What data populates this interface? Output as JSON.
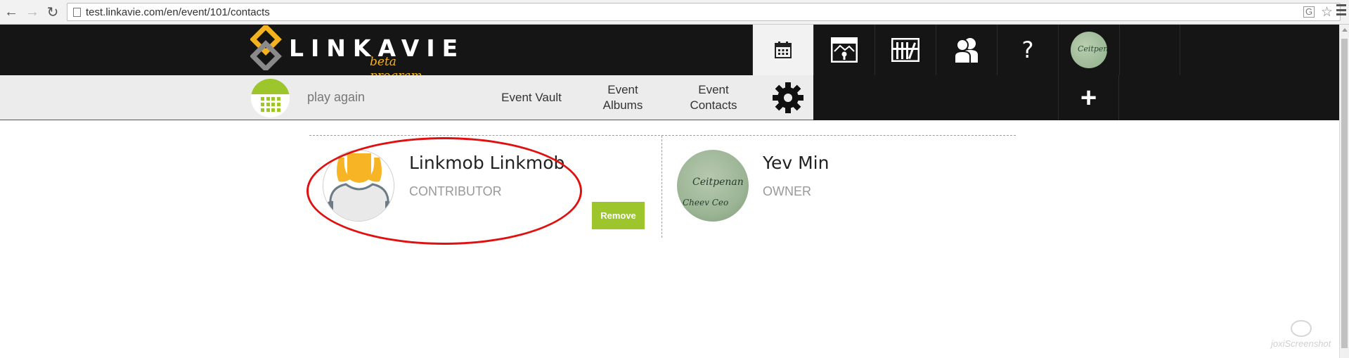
{
  "browser": {
    "url": "test.linkavie.com/en/event/101/contacts"
  },
  "brand": {
    "name": "LINKAVIE",
    "tagline": "beta program",
    "accent_color": "#f4b21e",
    "dark_color": "#151515"
  },
  "topnav": {
    "items": [
      {
        "name": "calendar-icon",
        "active": true
      },
      {
        "name": "vault-icon"
      },
      {
        "name": "albums-icon"
      },
      {
        "name": "contacts-icon"
      },
      {
        "name": "help",
        "label": "?"
      },
      {
        "name": "user-avatar"
      }
    ],
    "avatar_text": "Ceitpenan"
  },
  "event": {
    "name": "play again",
    "tabs": [
      {
        "label_1": "Event Vault",
        "label_2": ""
      },
      {
        "label_1": "Event",
        "label_2": "Albums"
      },
      {
        "label_1": "Event",
        "label_2": "Contacts"
      }
    ],
    "add_label": "+",
    "green_color": "#9cc62b"
  },
  "contacts": [
    {
      "name": "Linkmob Linkmob",
      "role": "CONTRIBUTOR",
      "action": "Remove",
      "avatar": "placeholder"
    },
    {
      "name": "Yev Min",
      "role": "OWNER",
      "avatar": "photo",
      "avatar_text_1": "Ceitpenan",
      "avatar_text_2": "Cheev  Ceo"
    }
  ],
  "annotation_color": "#e01010",
  "watermark": "joxiScreenshot"
}
